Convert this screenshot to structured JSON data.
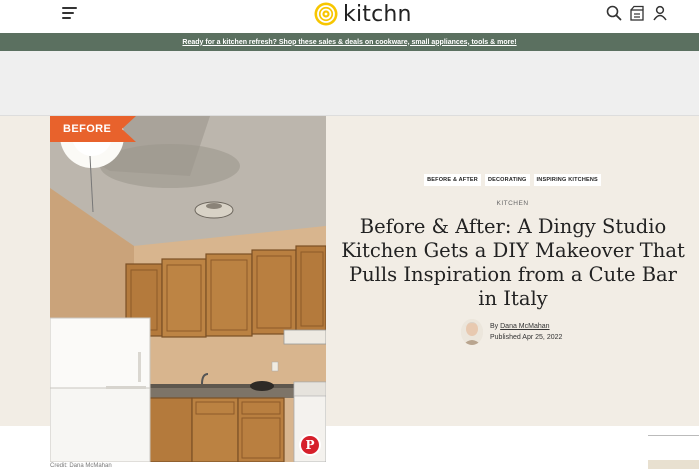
{
  "header": {
    "logo_text": "kitchn",
    "logo_color": "#f7c600",
    "icons": [
      "menu-icon",
      "search-icon",
      "box-icon",
      "user-icon"
    ]
  },
  "promo": {
    "text": "Ready for a kitchen refresh? Shop these sales & deals on cookware, small appliances, tools & more!",
    "background": "#5b7060"
  },
  "hero": {
    "badge": "BEFORE",
    "badge_color": "#e8622c",
    "background": "#f2ede5",
    "photo_credit": "Credit: Dana McMahan",
    "pin_icon_label": "P"
  },
  "article": {
    "tags": [
      "BEFORE & AFTER",
      "DECORATING",
      "INSPIRING KITCHENS"
    ],
    "category": "KITCHEN",
    "title": "Before & After: A Dingy Studio Kitchen Gets a DIY Makeover That Pulls Inspiration from a Cute Bar in Italy",
    "by_label": "By",
    "author": "Dana McMahan",
    "published": "Published Apr 25, 2022"
  }
}
